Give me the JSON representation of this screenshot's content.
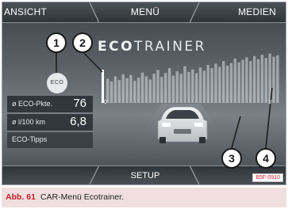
{
  "menu": {
    "left_label": "ANSICHT",
    "center_label": "MENÜ",
    "right_label": "MEDIEN",
    "bottom_label": "SETUP"
  },
  "eco": {
    "brand_part1": "ECO",
    "brand_part2": "TRAINER",
    "icon_text": "ECO",
    "scale_start": "0'",
    "scale_end": "3'",
    "stats": [
      {
        "label": "ø ECO-Pkte.",
        "value": "76"
      },
      {
        "label": "ø l/100 km",
        "value": "6,8"
      }
    ],
    "tips_label": "ECO-Tipps",
    "bar_levels": [
      0.38,
      0.34,
      0.42,
      0.36,
      0.45,
      0.39,
      0.44,
      0.35,
      0.4,
      0.48,
      0.42,
      0.37,
      0.46,
      0.52,
      0.41,
      0.47,
      0.55,
      0.43,
      0.5,
      0.46,
      0.58,
      0.49,
      0.53,
      0.47,
      0.56,
      0.51,
      0.6,
      0.55,
      0.62,
      0.57,
      0.66,
      0.59,
      0.63,
      0.7,
      0.64,
      0.68,
      0.72,
      0.66,
      0.74,
      0.69,
      0.76,
      0.71,
      0.78,
      0.73,
      0.75
    ]
  },
  "callouts": [
    "1",
    "2",
    "3",
    "4"
  ],
  "figure_code": "B5F-0910",
  "caption": {
    "number": "Abb. 61",
    "text": "CAR-Menü Ecotrainer."
  },
  "colors": {
    "screen_top": "#3e4449",
    "caption_bg": "#f1dfe0",
    "caption_accent": "#c8202a",
    "bar_color": "#d9dcdf"
  }
}
